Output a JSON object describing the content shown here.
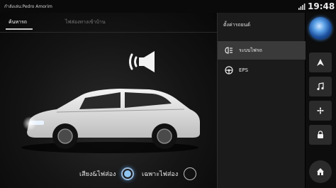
{
  "status_bar": {
    "user_text": "กำลังเล่น:Pedro Amorim",
    "clock": "19:48"
  },
  "left_panel": {
    "tabs": [
      {
        "label": "ค้นหารถ"
      },
      {
        "label": "ไฟส่องทางเข้าบ้าน"
      }
    ],
    "options": [
      {
        "label": "เสียง&ไฟส่อง",
        "selected": true
      },
      {
        "label": "เฉพาะไฟส่อง",
        "selected": false
      }
    ]
  },
  "settings_panel": {
    "title": "ตั้งค่ารถยนต์",
    "items": [
      {
        "label": "ระบบไฟรถ",
        "icon": "headlight-icon",
        "selected": true
      },
      {
        "label": "EPS",
        "icon": "steering-wheel-icon",
        "selected": false
      }
    ]
  },
  "nav_rail": {
    "items": [
      {
        "icon": "globe-icon"
      },
      {
        "icon": "navigation-arrow-icon"
      },
      {
        "icon": "music-note-icon"
      },
      {
        "icon": "fan-icon"
      },
      {
        "icon": "car-settings-icon"
      },
      {
        "icon": "home-icon"
      }
    ]
  },
  "colors": {
    "accent": "#8fc3f0",
    "panel": "#1b1b1b",
    "selected_row": "#3a3a3a"
  }
}
